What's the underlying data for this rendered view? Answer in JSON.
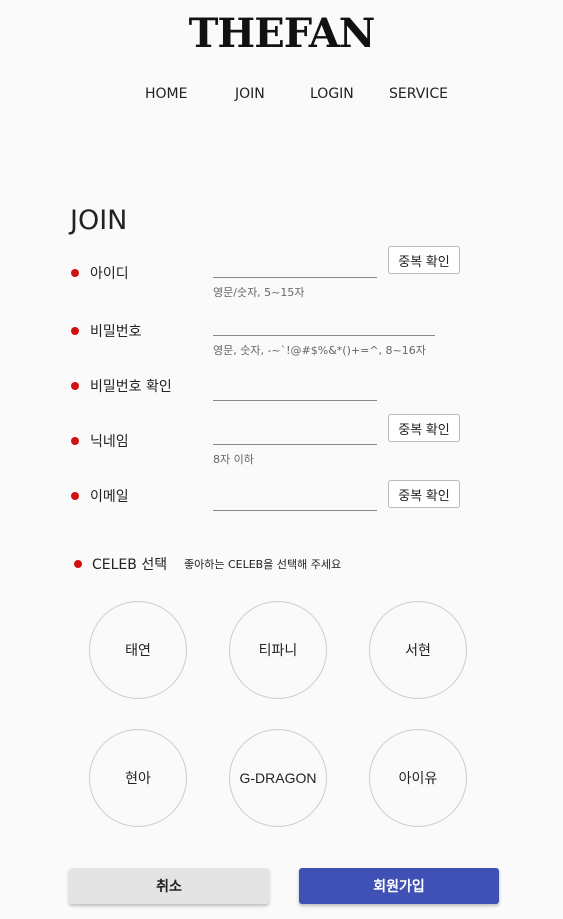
{
  "brand": {
    "logo_text": "THEFAN"
  },
  "nav": {
    "home": "HOME",
    "join": "JOIN",
    "login": "LOGIN",
    "service": "SERVICE"
  },
  "page": {
    "title": "JOIN"
  },
  "form": {
    "id": {
      "label": "아이디",
      "value": "",
      "hint": "영문/숫자, 5~15자",
      "check_label": "중복 확인"
    },
    "password": {
      "label": "비밀번호",
      "value": "",
      "hint": "영문, 숫자, -~`!@#$%&*()+=^, 8~16자"
    },
    "password_confirm": {
      "label": "비밀번호 확인",
      "value": ""
    },
    "nickname": {
      "label": "닉네임",
      "value": "",
      "hint": "8자 이하",
      "check_label": "중복 확인"
    },
    "email": {
      "label": "이메일",
      "value": "",
      "check_label": "중복 확인"
    }
  },
  "celeb": {
    "title": "CELEB 선택",
    "subtitle": "좋아하는 CELEB을 선택해 주세요",
    "options": [
      "태연",
      "티파니",
      "서현",
      "현아",
      "G-DRAGON",
      "아이유"
    ]
  },
  "actions": {
    "cancel": "취소",
    "submit": "회원가입"
  },
  "colors": {
    "required_dot": "#d21010",
    "submit_bg": "#3f51b5",
    "cancel_bg": "#e4e4e4"
  }
}
